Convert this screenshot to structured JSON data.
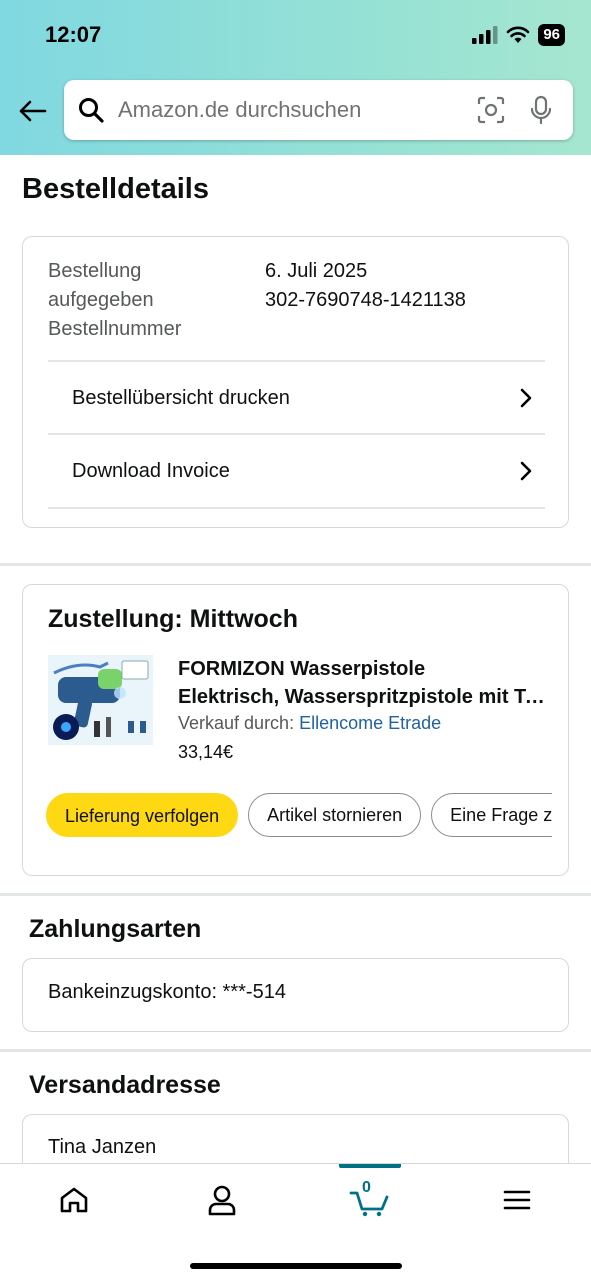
{
  "status_bar": {
    "time": "12:07",
    "battery": "96"
  },
  "search": {
    "placeholder": "Amazon.de durchsuchen"
  },
  "page": {
    "title": "Bestelldetails"
  },
  "order_info": {
    "label_line1": "Bestellung",
    "label_line2": "aufgegeben",
    "label_line3": "Bestellnummer",
    "date": "6. Juli 2025",
    "order_number": "302-7690748-1421138",
    "print_summary_label": "Bestellübersicht drucken",
    "download_invoice_label": "Download Invoice"
  },
  "delivery": {
    "title": "Zustellung: Mittwoch",
    "product_title_line1": "FORMIZON Wasserpistole",
    "product_title_line2": "Elektrisch, Wasserspritzpistole mit Tank",
    "seller_prefix": "Verkauf durch:",
    "seller_name": "Ellencome Etrade",
    "price": "33,14€",
    "buttons": {
      "track": "Lieferung verfolgen",
      "cancel": "Artikel stornieren",
      "question": "Eine Frage zum Produkt stellen"
    }
  },
  "payment": {
    "title": "Zahlungsarten",
    "method": "Bankeinzugskonto: ***-514"
  },
  "shipping": {
    "title": "Versandadresse",
    "name": "Tina Janzen"
  },
  "bottom_nav": {
    "cart_count": "0",
    "icons": [
      "home-icon",
      "account-icon",
      "cart-icon",
      "menu-icon"
    ],
    "active_color": "#007185"
  },
  "colors": {
    "accent_button": "#ffd814",
    "link": "#2162a1"
  }
}
